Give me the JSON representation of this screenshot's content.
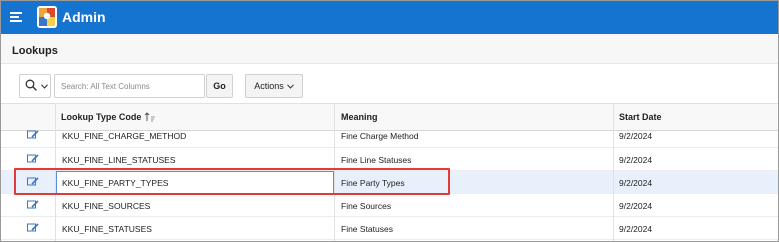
{
  "app": {
    "title": "Admin",
    "menu_icon": "hamburger-icon",
    "logo_icon": "app-logo-icon"
  },
  "region": {
    "title": "Lookups"
  },
  "toolbar": {
    "search_placeholder": "Search: All Text Columns",
    "search_value": "",
    "go_label": "Go",
    "actions_label": "Actions"
  },
  "grid": {
    "columns": [
      {
        "label": "",
        "key": "edit"
      },
      {
        "label": "Lookup Type Code",
        "key": "code",
        "sort": "ascending"
      },
      {
        "label": "Meaning",
        "key": "meaning"
      },
      {
        "label": "Start Date",
        "key": "start_date"
      }
    ],
    "rows": [
      {
        "code": "KKU_FINE_CHARGE_METHOD",
        "meaning": "Fine Charge Method",
        "start_date": "9/2/2024"
      },
      {
        "code": "KKU_FINE_LINE_STATUSES",
        "meaning": "Fine Line Statuses",
        "start_date": "9/2/2024"
      },
      {
        "code": "KKU_FINE_PARTY_TYPES",
        "meaning": "Fine Party Types",
        "start_date": "9/2/2024",
        "selected": true
      },
      {
        "code": "KKU_FINE_SOURCES",
        "meaning": "Fine Sources",
        "start_date": "9/2/2024"
      },
      {
        "code": "KKU_FINE_STATUSES",
        "meaning": "Fine Statuses",
        "start_date": "9/2/2024"
      }
    ]
  },
  "colors": {
    "topbar": "#1674d1",
    "highlight_outline": "#e03a3a",
    "selected_row": "#e8f1fb"
  }
}
